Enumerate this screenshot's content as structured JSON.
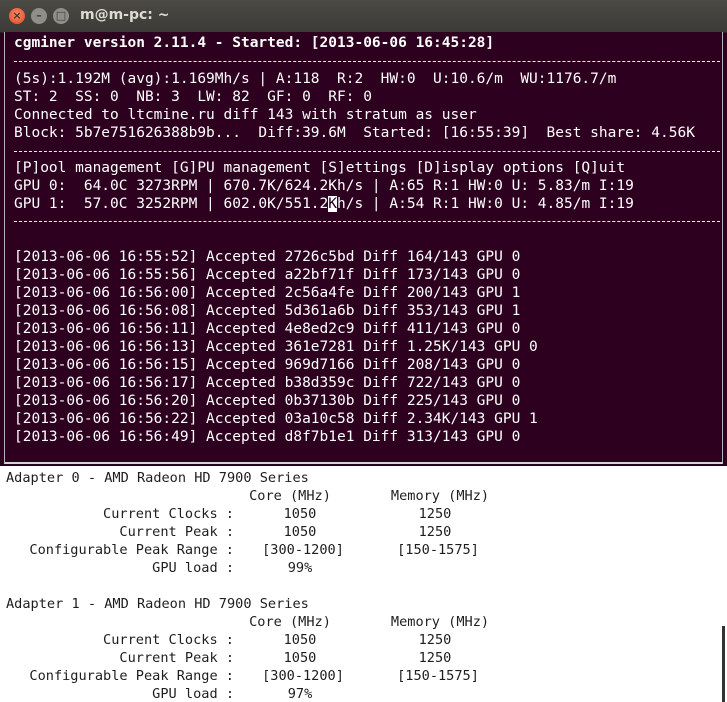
{
  "window": {
    "title": "m@m-pc: ~",
    "close_glyph": "×",
    "minimize_glyph": "–",
    "maximize_glyph": "□"
  },
  "cgminer": {
    "header": "cgminer version 2.11.4 - Started: [2013-06-06 16:45:28]",
    "stats1": "(5s):1.192M (avg):1.169Mh/s | A:118  R:2  HW:0  U:10.6/m  WU:1176.7/m",
    "stats2": "ST: 2  SS: 0  NB: 3  LW: 82  GF: 0  RF: 0",
    "connection": "Connected to ltcmine.ru diff 143 with stratum as user",
    "block": "Block: 5b7e751626388b9b...  Diff:39.6M  Started: [16:55:39]  Best share: 4.56K",
    "menu": "[P]ool management [G]PU management [S]ettings [D]isplay options [Q]uit",
    "gpu0": "GPU 0:  64.0C 3273RPM | 670.7K/624.2Kh/s | A:65 R:1 HW:0 U: 5.83/m I:19",
    "gpu1_a": "GPU 1:  57.0C 3252RPM | 602.0K/551.2",
    "gpu1_cursor": "K",
    "gpu1_b": "h/s | A:54 R:1 HW:0 U: 4.85/m I:19",
    "log": [
      "[2013-06-06 16:55:52] Accepted 2726c5bd Diff 164/143 GPU 0",
      "[2013-06-06 16:55:56] Accepted a22bf71f Diff 173/143 GPU 0",
      "[2013-06-06 16:56:00] Accepted 2c56a4fe Diff 200/143 GPU 1",
      "[2013-06-06 16:56:08] Accepted 5d361a6b Diff 353/143 GPU 1",
      "[2013-06-06 16:56:11] Accepted 4e8ed2c9 Diff 411/143 GPU 0",
      "[2013-06-06 16:56:13] Accepted 361e7281 Diff 1.25K/143 GPU 0",
      "[2013-06-06 16:56:15] Accepted 969d7166 Diff 208/143 GPU 0",
      "[2013-06-06 16:56:17] Accepted b38d359c Diff 722/143 GPU 0",
      "[2013-06-06 16:56:20] Accepted 0b37130b Diff 225/143 GPU 0",
      "[2013-06-06 16:56:22] Accepted 03a10c58 Diff 2.34K/143 GPU 1",
      "[2013-06-06 16:56:49] Accepted d8f7b1e1 Diff 313/143 GPU 0"
    ]
  },
  "aticonfig": {
    "core_header": "Core (MHz)",
    "memory_header": "Memory (MHz)",
    "label_current_clocks": "Current Clocks :",
    "label_current_peak": "Current Peak :",
    "label_peak_range": "Configurable Peak Range :",
    "label_gpu_load": "GPU load :",
    "adapters": [
      {
        "title": "Adapter 0 - AMD Radeon HD 7900 Series",
        "current_core": "1050",
        "current_memory": "1250",
        "peak_core": "1050",
        "peak_memory": "1250",
        "range_core": "[300-1200]",
        "range_memory": "[150-1575]",
        "gpu_load": "99%"
      },
      {
        "title": "Adapter 1 - AMD Radeon HD 7900 Series",
        "current_core": "1050",
        "current_memory": "1250",
        "peak_core": "1050",
        "peak_memory": "1250",
        "range_core": "[300-1200]",
        "range_memory": "[150-1575]",
        "gpu_load": "97%"
      }
    ]
  },
  "colors": {
    "terminal_bg": "#2c001e",
    "terminal_fg": "#ffffff",
    "lower_bg": "#ffffff",
    "lower_fg": "#1e1e1e",
    "close_button": "#df4b16"
  }
}
